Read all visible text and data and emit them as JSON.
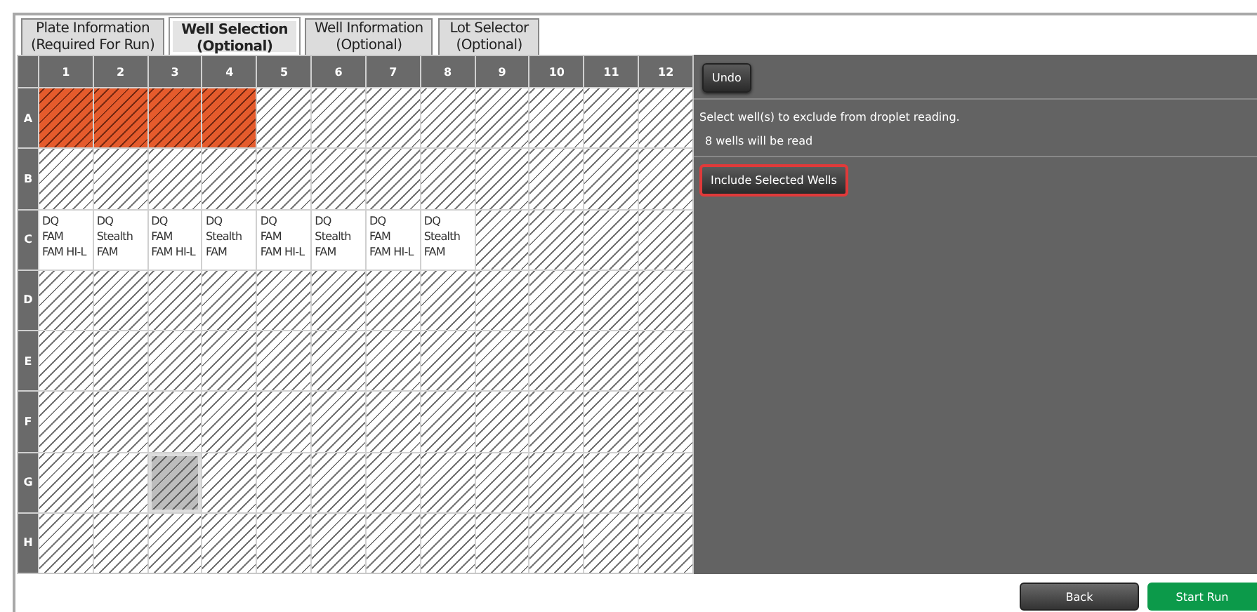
{
  "tabs": [
    {
      "lines": [
        "Plate Information",
        "(Required For Run)"
      ],
      "selected": false
    },
    {
      "lines": [
        "Well Selection",
        "(Optional)"
      ],
      "selected": true
    },
    {
      "lines": [
        "Well Information",
        "(Optional)"
      ],
      "selected": false
    },
    {
      "lines": [
        "Lot Selector",
        "(Optional)"
      ],
      "selected": false
    }
  ],
  "plate": {
    "columns": [
      "1",
      "2",
      "3",
      "4",
      "5",
      "6",
      "7",
      "8",
      "9",
      "10",
      "11",
      "12"
    ],
    "rows": [
      {
        "label": "A",
        "wells": [
          {
            "excluded": true,
            "selected": false
          },
          {
            "excluded": true,
            "selected": false
          },
          {
            "excluded": true,
            "selected": false
          },
          {
            "excluded": true,
            "selected": false
          },
          {
            "excluded": false,
            "selected": false
          },
          {
            "excluded": false,
            "selected": false
          },
          {
            "excluded": false,
            "selected": false
          },
          {
            "excluded": false,
            "selected": false
          },
          {
            "excluded": false,
            "selected": false
          },
          {
            "excluded": false,
            "selected": false
          },
          {
            "excluded": false,
            "selected": false
          },
          {
            "excluded": false,
            "selected": false
          }
        ]
      },
      {
        "label": "B",
        "wells": [
          {
            "excluded": false,
            "selected": false
          },
          {
            "excluded": false,
            "selected": false
          },
          {
            "excluded": false,
            "selected": false
          },
          {
            "excluded": false,
            "selected": false
          },
          {
            "excluded": false,
            "selected": false
          },
          {
            "excluded": false,
            "selected": false
          },
          {
            "excluded": false,
            "selected": false
          },
          {
            "excluded": false,
            "selected": false
          },
          {
            "excluded": false,
            "selected": false
          },
          {
            "excluded": false,
            "selected": false
          },
          {
            "excluded": false,
            "selected": false
          },
          {
            "excluded": false,
            "selected": false
          }
        ]
      },
      {
        "label": "C",
        "wells": [
          {
            "excluded": false,
            "selected": false,
            "lines": [
              "DQ",
              "FAM",
              "FAM HI-L"
            ]
          },
          {
            "excluded": false,
            "selected": false,
            "lines": [
              "DQ",
              "Stealth",
              "FAM"
            ]
          },
          {
            "excluded": false,
            "selected": false,
            "lines": [
              "DQ",
              "FAM",
              "FAM HI-L"
            ]
          },
          {
            "excluded": false,
            "selected": false,
            "lines": [
              "DQ",
              "Stealth",
              "FAM"
            ]
          },
          {
            "excluded": false,
            "selected": false,
            "lines": [
              "DQ",
              "FAM",
              "FAM HI-L"
            ]
          },
          {
            "excluded": false,
            "selected": false,
            "lines": [
              "DQ",
              "Stealth",
              "FAM"
            ]
          },
          {
            "excluded": false,
            "selected": false,
            "lines": [
              "DQ",
              "FAM",
              "FAM HI-L"
            ]
          },
          {
            "excluded": false,
            "selected": false,
            "lines": [
              "DQ",
              "Stealth",
              "FAM"
            ]
          },
          {
            "excluded": false,
            "selected": false
          },
          {
            "excluded": false,
            "selected": false
          },
          {
            "excluded": false,
            "selected": false
          },
          {
            "excluded": false,
            "selected": false
          }
        ]
      },
      {
        "label": "D",
        "wells": [
          {
            "excluded": false,
            "selected": false
          },
          {
            "excluded": false,
            "selected": false
          },
          {
            "excluded": false,
            "selected": false
          },
          {
            "excluded": false,
            "selected": false
          },
          {
            "excluded": false,
            "selected": false
          },
          {
            "excluded": false,
            "selected": false
          },
          {
            "excluded": false,
            "selected": false
          },
          {
            "excluded": false,
            "selected": false
          },
          {
            "excluded": false,
            "selected": false
          },
          {
            "excluded": false,
            "selected": false
          },
          {
            "excluded": false,
            "selected": false
          },
          {
            "excluded": false,
            "selected": false
          }
        ]
      },
      {
        "label": "E",
        "wells": [
          {
            "excluded": false,
            "selected": false
          },
          {
            "excluded": false,
            "selected": false
          },
          {
            "excluded": false,
            "selected": false
          },
          {
            "excluded": false,
            "selected": false
          },
          {
            "excluded": false,
            "selected": false
          },
          {
            "excluded": false,
            "selected": false
          },
          {
            "excluded": false,
            "selected": false
          },
          {
            "excluded": false,
            "selected": false
          },
          {
            "excluded": false,
            "selected": false
          },
          {
            "excluded": false,
            "selected": false
          },
          {
            "excluded": false,
            "selected": false
          },
          {
            "excluded": false,
            "selected": false
          }
        ]
      },
      {
        "label": "F",
        "wells": [
          {
            "excluded": false,
            "selected": false
          },
          {
            "excluded": false,
            "selected": false
          },
          {
            "excluded": false,
            "selected": false
          },
          {
            "excluded": false,
            "selected": false
          },
          {
            "excluded": false,
            "selected": false
          },
          {
            "excluded": false,
            "selected": false
          },
          {
            "excluded": false,
            "selected": false
          },
          {
            "excluded": false,
            "selected": false
          },
          {
            "excluded": false,
            "selected": false
          },
          {
            "excluded": false,
            "selected": false
          },
          {
            "excluded": false,
            "selected": false
          },
          {
            "excluded": false,
            "selected": false
          }
        ]
      },
      {
        "label": "G",
        "wells": [
          {
            "excluded": false,
            "selected": false
          },
          {
            "excluded": false,
            "selected": false
          },
          {
            "excluded": false,
            "selected": true
          },
          {
            "excluded": false,
            "selected": false
          },
          {
            "excluded": false,
            "selected": false
          },
          {
            "excluded": false,
            "selected": false
          },
          {
            "excluded": false,
            "selected": false
          },
          {
            "excluded": false,
            "selected": false
          },
          {
            "excluded": false,
            "selected": false
          },
          {
            "excluded": false,
            "selected": false
          },
          {
            "excluded": false,
            "selected": false
          },
          {
            "excluded": false,
            "selected": false
          }
        ]
      },
      {
        "label": "H",
        "wells": [
          {
            "excluded": false,
            "selected": false
          },
          {
            "excluded": false,
            "selected": false
          },
          {
            "excluded": false,
            "selected": false
          },
          {
            "excluded": false,
            "selected": false
          },
          {
            "excluded": false,
            "selected": false
          },
          {
            "excluded": false,
            "selected": false
          },
          {
            "excluded": false,
            "selected": false
          },
          {
            "excluded": false,
            "selected": false
          },
          {
            "excluded": false,
            "selected": false
          },
          {
            "excluded": false,
            "selected": false
          },
          {
            "excluded": false,
            "selected": false
          },
          {
            "excluded": false,
            "selected": false
          }
        ]
      }
    ]
  },
  "side_panel": {
    "undo_button": "Undo",
    "instruction": "Select well(s) to exclude from droplet reading.",
    "status": "8 wells will be read",
    "include_button": {
      "label": "Include Selected Wells",
      "highlighted": true
    }
  },
  "footer": {
    "back_button": "Back",
    "start_button": "Start Run"
  }
}
